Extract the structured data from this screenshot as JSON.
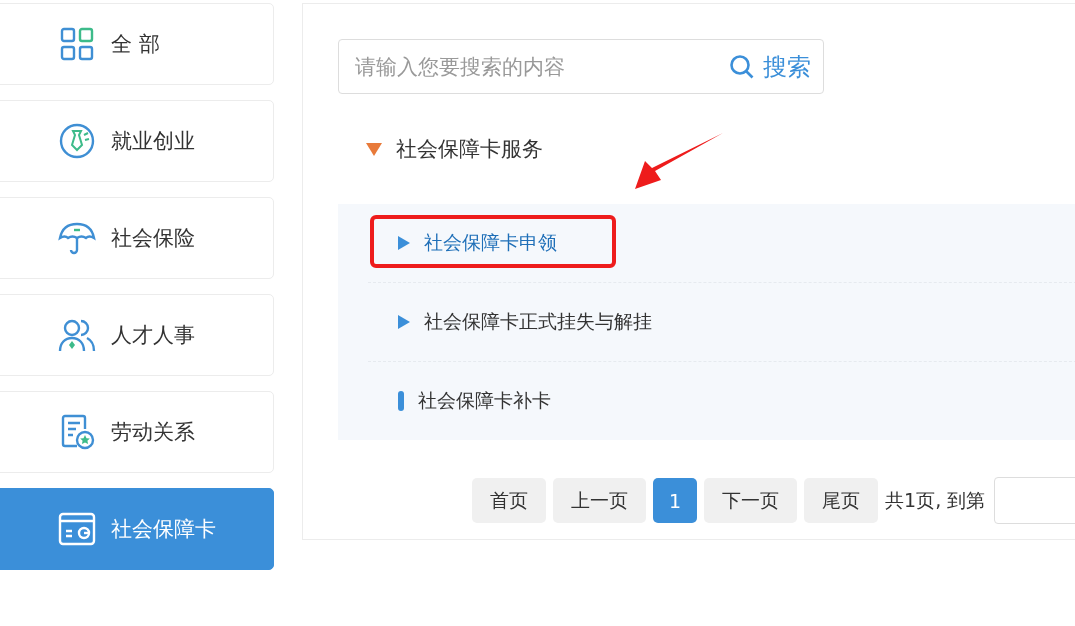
{
  "sidebar": {
    "items": [
      {
        "label": "全 部",
        "kind": "grid",
        "selected": false
      },
      {
        "label": "就业创业",
        "kind": "tie",
        "selected": false
      },
      {
        "label": "社会保险",
        "kind": "umbrella",
        "selected": false
      },
      {
        "label": "人才人事",
        "kind": "people",
        "selected": false
      },
      {
        "label": "劳动关系",
        "kind": "document",
        "selected": false
      },
      {
        "label": "社会保障卡",
        "kind": "card",
        "selected": true
      }
    ]
  },
  "search": {
    "placeholder": "请输入您要搜索的内容",
    "button": "搜索"
  },
  "tree": {
    "label": "社会保障卡服务",
    "expanded": true,
    "children": [
      {
        "label": "社会保障卡申领",
        "kind": "expandable",
        "selected": true,
        "annotated": true
      },
      {
        "label": "社会保障卡正式挂失与解挂",
        "kind": "expandable",
        "selected": false,
        "annotated": false
      },
      {
        "label": "社会保障卡补卡",
        "kind": "leaf",
        "selected": false,
        "annotated": false
      }
    ]
  },
  "pagination": {
    "buttons": [
      {
        "label": "首页",
        "selected": false
      },
      {
        "label": "上一页",
        "selected": false
      },
      {
        "label": "1",
        "selected": true
      },
      {
        "label": "下一页",
        "selected": false
      },
      {
        "label": "尾页",
        "selected": false
      }
    ],
    "info": "共1页, 到第"
  }
}
